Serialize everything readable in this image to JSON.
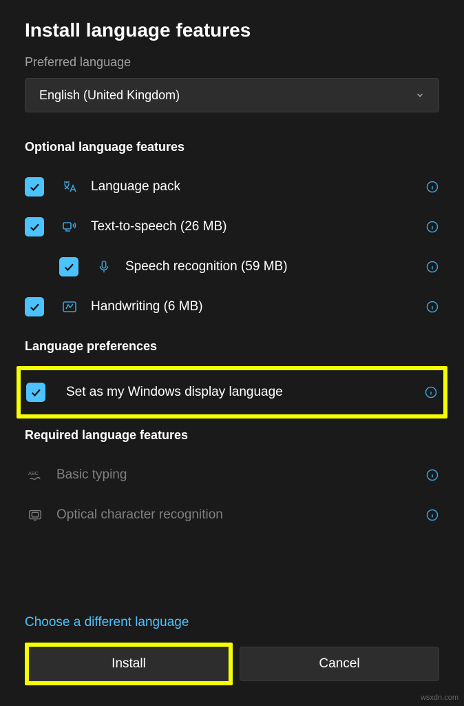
{
  "title": "Install language features",
  "preferred_label": "Preferred language",
  "dropdown_value": "English (United Kingdom)",
  "optional_header": "Optional language features",
  "rows": {
    "language_pack": "Language pack",
    "tts": "Text-to-speech (26 MB)",
    "speech": "Speech recognition (59 MB)",
    "handwriting": "Handwriting (6 MB)"
  },
  "prefs_header": "Language preferences",
  "set_display": "Set as my Windows display language",
  "required_header": "Required language features",
  "basic_typing": "Basic typing",
  "ocr": "Optical character recognition",
  "choose_diff": "Choose a different language",
  "install_btn": "Install",
  "cancel_btn": "Cancel",
  "watermark": "wsxdn.com"
}
